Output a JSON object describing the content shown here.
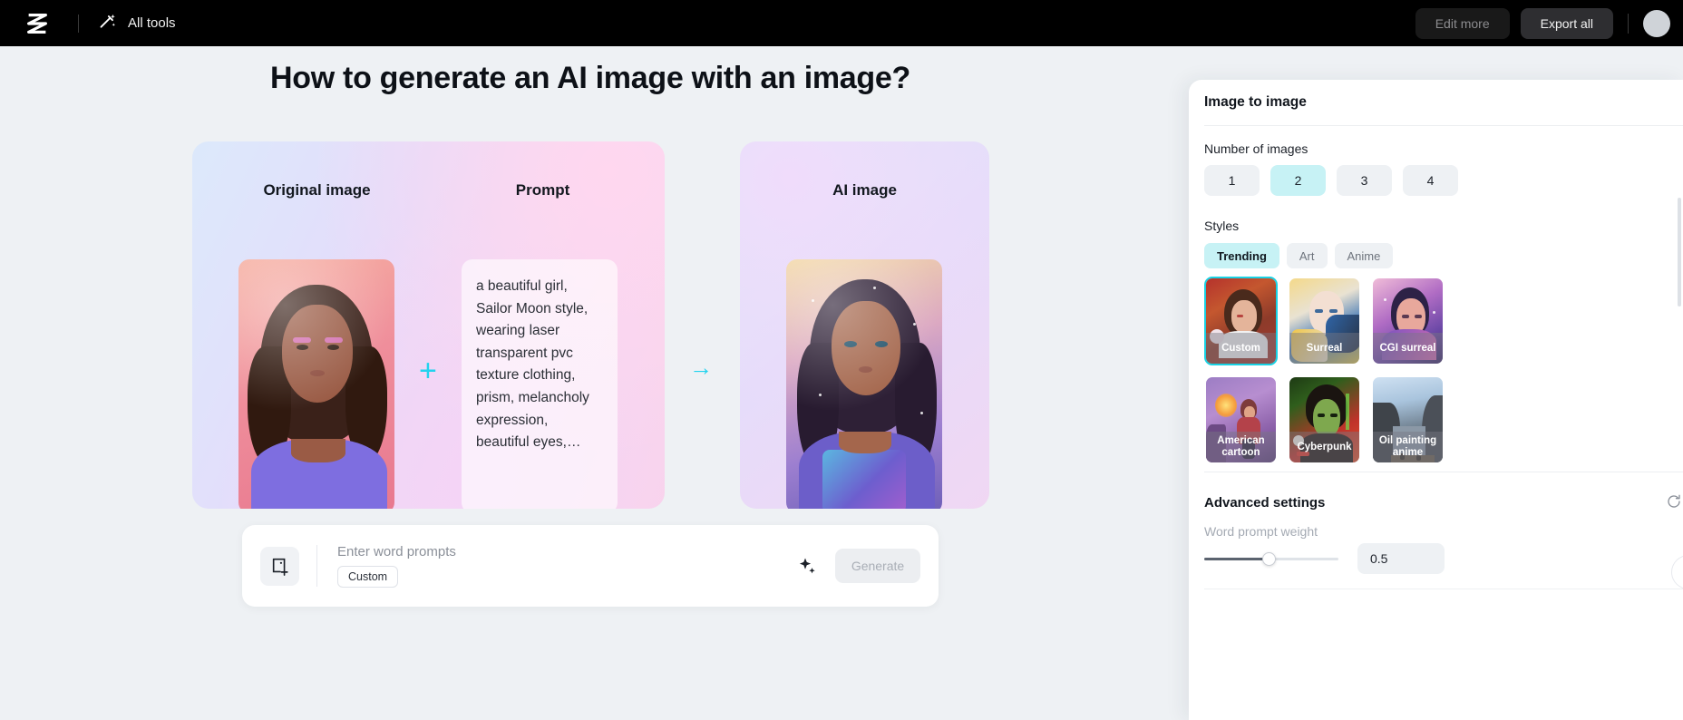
{
  "topbar": {
    "logo_icon": "capcut-logo-icon",
    "all_tools_icon": "magic-wand-icon",
    "all_tools_label": "All tools",
    "edit_more_label": "Edit more",
    "export_all_label": "Export all",
    "avatar_icon": "user-avatar"
  },
  "main": {
    "page_title": "How to generate an AI image with an image?",
    "original_heading": "Original image",
    "prompt_heading": "Prompt",
    "ai_heading": "AI image",
    "prompt_text": "a beautiful girl, Sailor Moon style, wearing laser transparent pvc texture clothing, prism, melancholy expression, beautiful eyes,…",
    "plus_icon": "plus-icon",
    "arrow_icon": "arrow-right-icon",
    "plus_color": "#22d3ee",
    "arrow_color": "#22d3ee"
  },
  "promptbar": {
    "upload_icon": "add-image-icon",
    "placeholder": "Enter word prompts",
    "chip_label": "Custom",
    "magic_icon": "sparkle-wand-icon",
    "generate_label": "Generate"
  },
  "panel": {
    "title": "Image to image",
    "number_of_images_label": "Number of images",
    "number_options": [
      "1",
      "2",
      "3",
      "4"
    ],
    "number_selected": "2",
    "styles_label": "Styles",
    "style_tabs": [
      "Trending",
      "Art",
      "Anime"
    ],
    "style_tab_selected": "Trending",
    "style_cards": [
      {
        "label": "Custom",
        "selected": true
      },
      {
        "label": "Surreal",
        "selected": false
      },
      {
        "label": "CGI surreal",
        "selected": false
      },
      {
        "label": "American cartoon",
        "selected": false
      },
      {
        "label": "Cyberpunk",
        "selected": false
      },
      {
        "label": "Oil painting anime",
        "selected": false
      }
    ],
    "advanced_settings_label": "Advanced settings",
    "reset_icon": "reset-icon",
    "word_prompt_weight_label": "Word prompt weight",
    "word_prompt_weight_value": "0.5",
    "accent_color": "#18d2e4",
    "selected_chip_color": "#c7f2f5"
  }
}
